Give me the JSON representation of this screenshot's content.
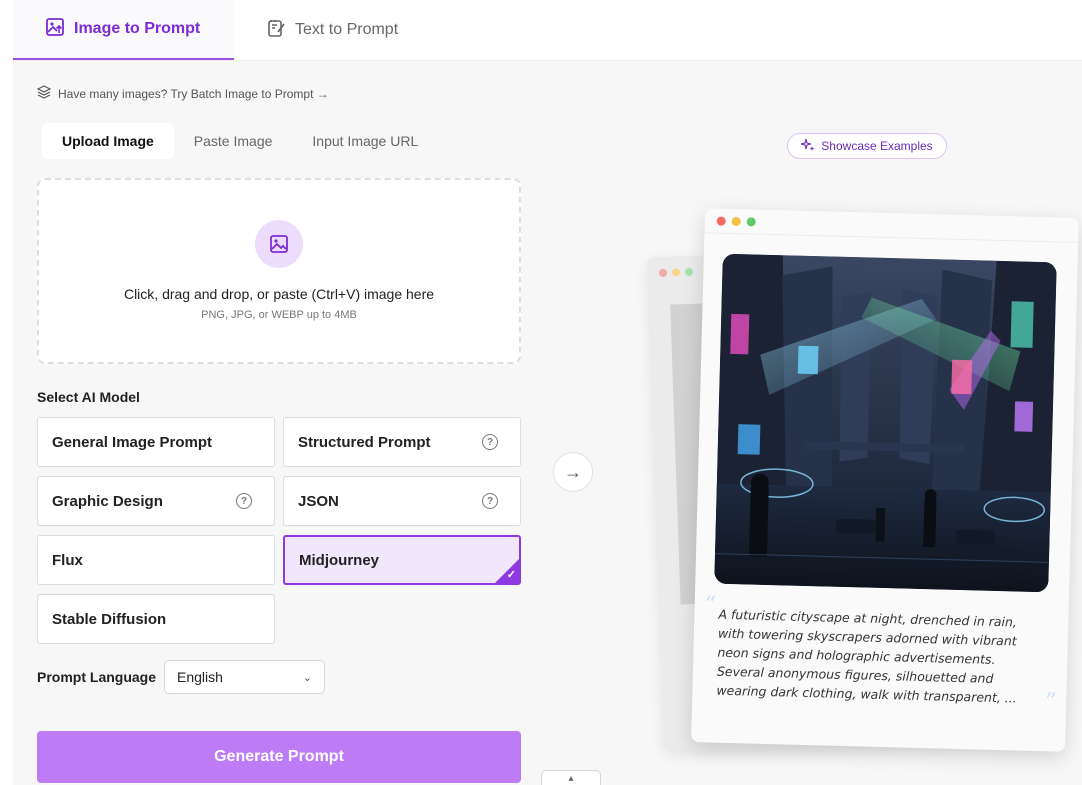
{
  "top_tabs": [
    {
      "label": "Image to Prompt",
      "icon": "image-upload-icon",
      "active": true
    },
    {
      "label": "Text to Prompt",
      "icon": "edit-note-icon",
      "active": false
    }
  ],
  "batch_hint": "Have many images? Try Batch Image to Prompt →",
  "sub_tabs": [
    {
      "label": "Upload Image",
      "active": true
    },
    {
      "label": "Paste Image",
      "active": false
    },
    {
      "label": "Input Image URL",
      "active": false
    }
  ],
  "dropzone": {
    "title": "Click, drag and drop, or paste (Ctrl+V) image here",
    "subtitle": "PNG, JPG, or WEBP up to 4MB",
    "icon": "image-icon"
  },
  "model_section": {
    "label": "Select AI Model",
    "models": [
      {
        "label": "General Image Prompt",
        "help": false,
        "selected": false
      },
      {
        "label": "Structured Prompt",
        "help": true,
        "selected": false
      },
      {
        "label": "Graphic Design",
        "help": true,
        "selected": false
      },
      {
        "label": "JSON",
        "help": true,
        "selected": false
      },
      {
        "label": "Flux",
        "help": false,
        "selected": false
      },
      {
        "label": "Midjourney",
        "help": false,
        "selected": true
      },
      {
        "label": "Stable Diffusion",
        "help": false,
        "selected": false
      }
    ]
  },
  "language": {
    "label": "Prompt Language",
    "value": "English"
  },
  "generate_label": "Generate Prompt",
  "showcase_label": "Showcase Examples",
  "preview": {
    "caption": "A futuristic cityscape at night, drenched in rain, with towering skyscrapers adorned with vibrant neon signs and holographic advertisements. Several anonymous figures, silhouetted and wearing dark clothing, walk with transparent, ..."
  },
  "colors": {
    "accent": "#8f39e3",
    "accent_text": "#7c2cd6",
    "generate_bg": "#bd7cf6",
    "selected_bg": "#f1e7fd",
    "dot_red": "#f26b63",
    "dot_yellow": "#f6c244",
    "dot_green": "#5fca6a"
  }
}
